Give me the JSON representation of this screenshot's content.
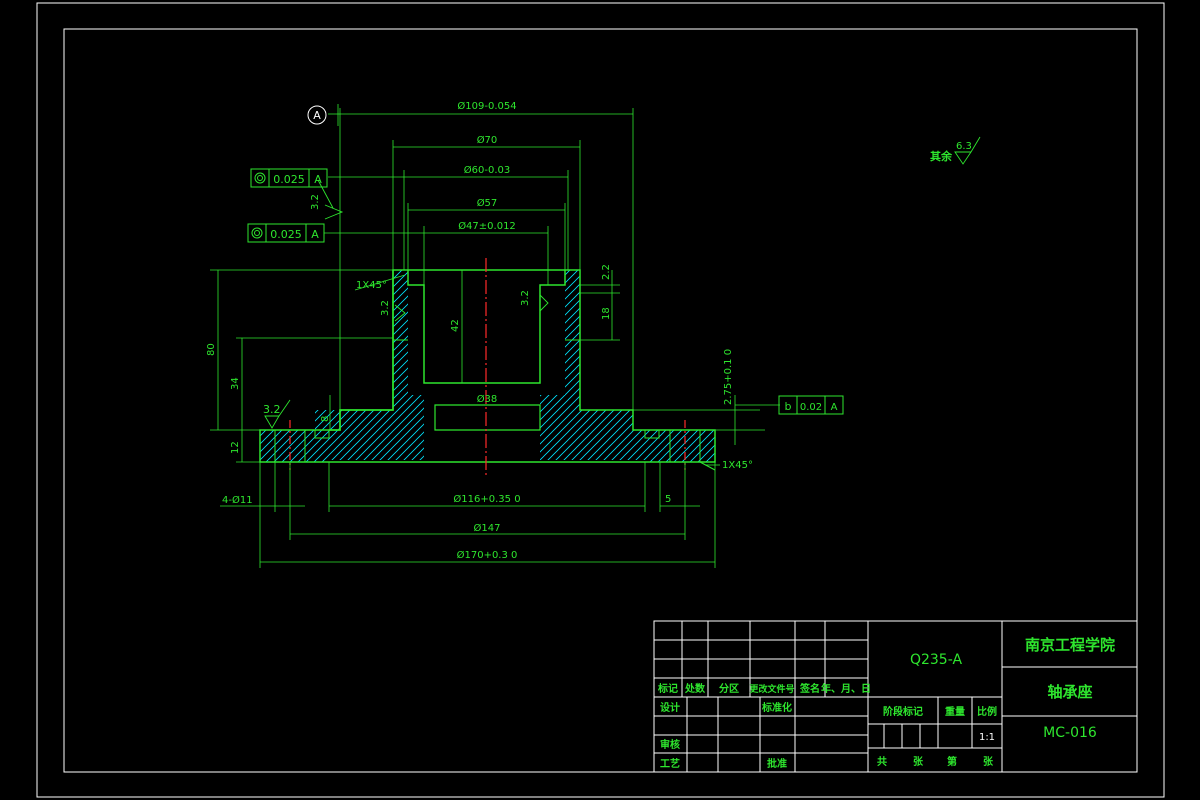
{
  "colors": {
    "background": "#000000",
    "line": "#2ee62e",
    "border": "#ffffff",
    "center_line": "#ff2a2a",
    "hatch": "#00e5ff"
  },
  "datum": {
    "letter": "A"
  },
  "dimensions": {
    "d109": "Ø109-0.054",
    "d70": "Ø70",
    "d60": "Ø60-0.03",
    "d57": "Ø57",
    "d47": "Ø47±0.012",
    "d38": "Ø38",
    "d116": "Ø116+0.35 0",
    "d147": "Ø147",
    "d170": "Ø170+0.3 0",
    "holes": "4-Ø11",
    "h80": "80",
    "h34": "34",
    "h42": "42",
    "h18": "18",
    "h12": "12",
    "h8": "8",
    "h2": "2.2",
    "h275": "2.75+0.1 0",
    "d5": "5",
    "chamfer": "1X45°"
  },
  "tolerances": {
    "tol1": {
      "value": "0.025",
      "datum": "A"
    },
    "tol2": {
      "value": "0.025",
      "datum": "A"
    },
    "tol3": {
      "symbol": "b",
      "value": "0.02",
      "datum": "A"
    }
  },
  "roughness": {
    "r1": "3.2",
    "r2": "3.2",
    "r3": "3.2",
    "r4": "3.2",
    "rest_label": "其余",
    "rest_value": "6.3"
  },
  "title_block": {
    "material": "Q235-A",
    "school": "南京工程学院",
    "part_name": "轴承座",
    "drawing_no": "MC-016",
    "headers": [
      "标记",
      "处数",
      "分区",
      "更改文件号",
      "签名",
      "年、月、日"
    ],
    "design": "设计",
    "standardize": "标准化",
    "review": "审核",
    "process": "工艺",
    "approve": "批准",
    "stage_mark": "阶段标记",
    "weight": "重量",
    "scale": "比例",
    "scale_value": "1:1",
    "total": "共",
    "sheets": "张",
    "sheet_no": "第",
    "sheet_unit": "张"
  }
}
